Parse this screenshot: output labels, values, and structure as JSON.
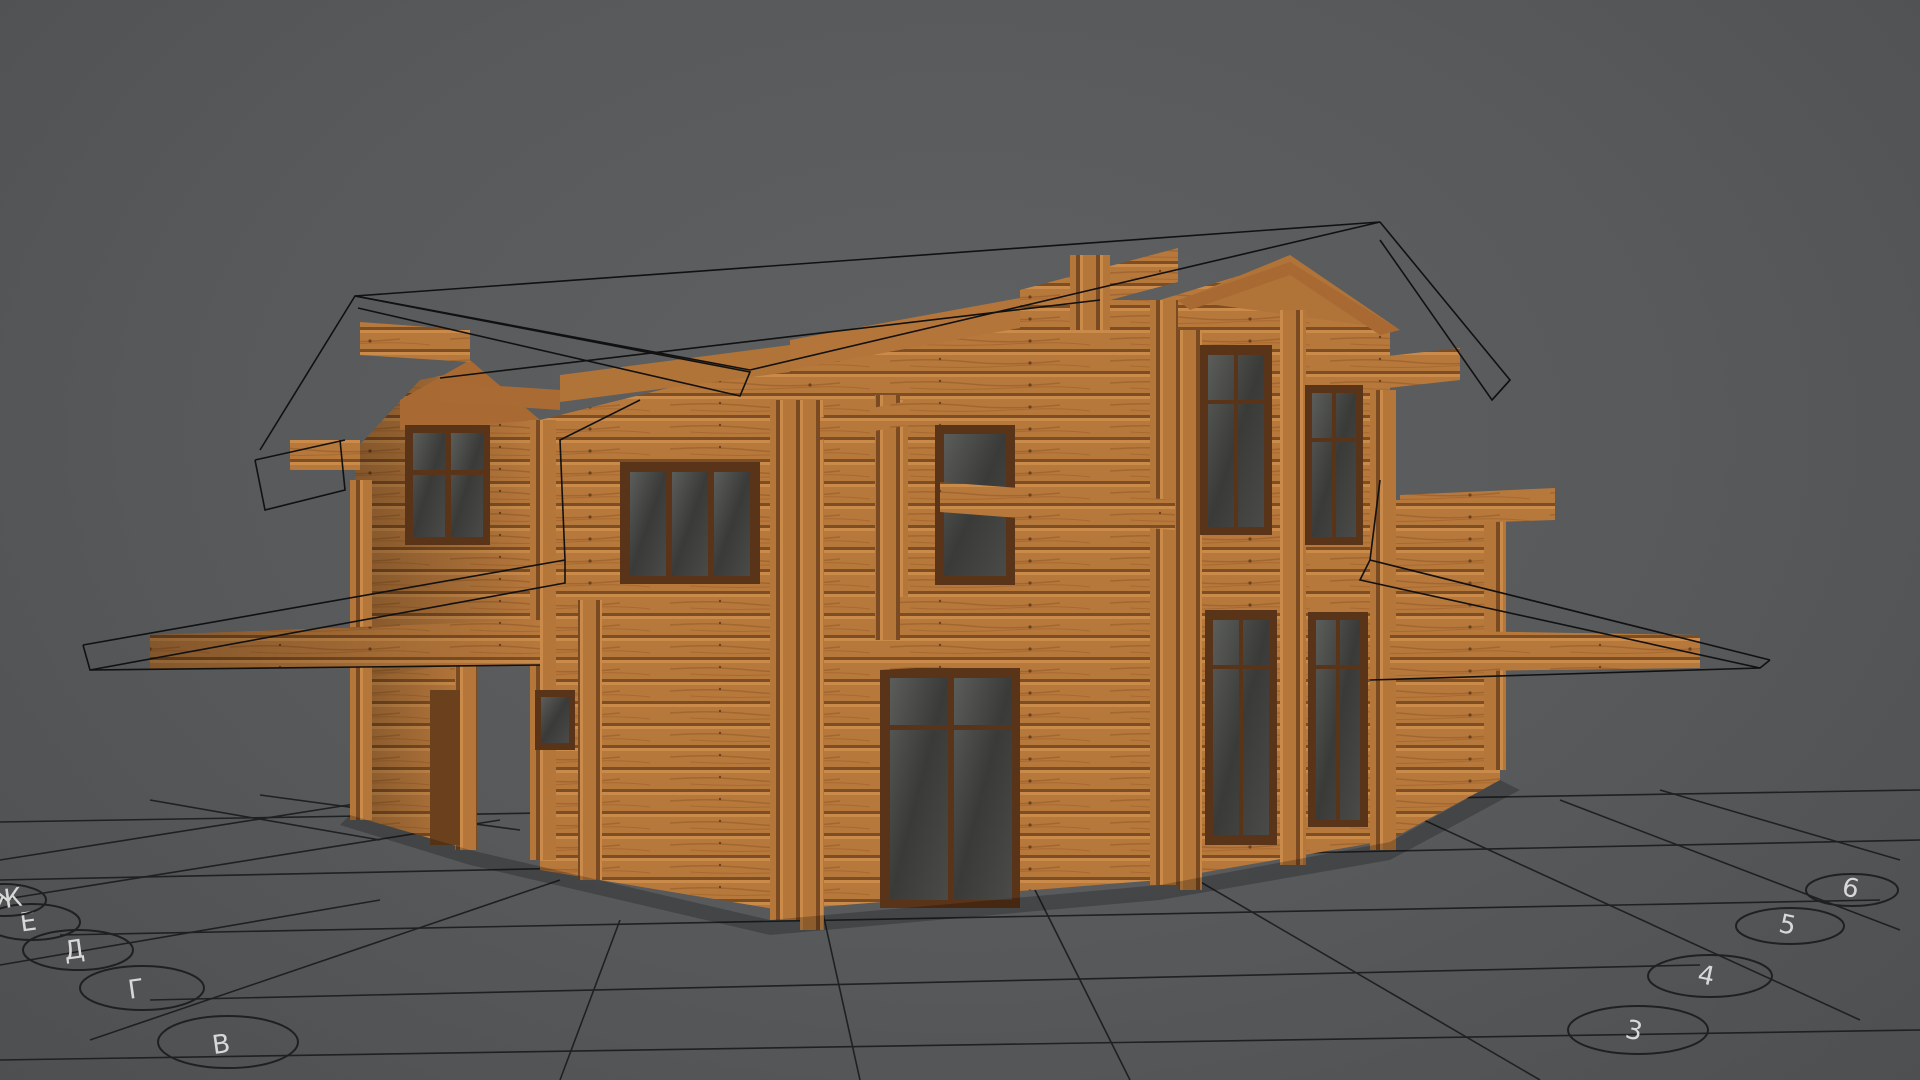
{
  "viewport": {
    "background_color": "#57595b",
    "wood_color": "#b7783c",
    "wood_shadow_color": "#7a4c22",
    "frame_color": "#5a3418",
    "glass_color": "#3d3e3c",
    "wireframe_color": "#111111",
    "grid_line_color": "#1f2021"
  },
  "grid_axes": {
    "letters": [
      "В",
      "Г",
      "Д",
      "Е",
      "Ж"
    ],
    "numbers": [
      "3",
      "4",
      "5",
      "6"
    ]
  }
}
